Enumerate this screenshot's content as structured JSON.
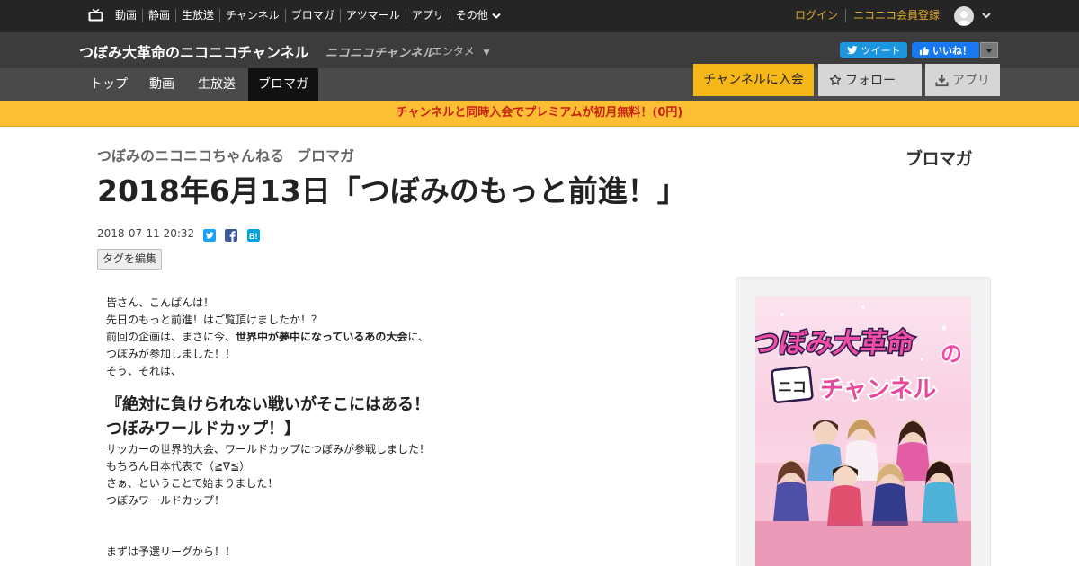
{
  "global_nav": {
    "items": [
      "動画",
      "静画",
      "生放送",
      "チャンネル",
      "ブロマガ",
      "アツマール",
      "アプリ"
    ],
    "more_label": "その他",
    "login_label": "ログイン",
    "signup_label": "ニコニコ会員登録"
  },
  "channel": {
    "name": "つぼみ大革命のニコニコチャンネル",
    "service_logo": "ニコニコチャンネル",
    "genre": "エンタメ",
    "tweet_label": "ツイート",
    "like_label": "いいね！",
    "tabs": [
      "トップ",
      "動画",
      "生放送",
      "ブロマガ"
    ],
    "active_tab": "ブロマガ",
    "join_label": "チャンネルに入会",
    "follow_label": "フォロー",
    "app_label": "アプリ"
  },
  "promo": {
    "text": "チャンネルと同時入会でプレミアムが初月無料！(0円)"
  },
  "article": {
    "channel_short": "つぼみのニコニコちゃんねる",
    "section": "ブロマガ",
    "logo_text": "ブロマガ",
    "title": "2018年6月13日「つぼみのもっと前進！」",
    "date": "2018-07-11 20:32",
    "tag_edit_label": "タグを編集",
    "lines": {
      "l1": "皆さん、こんばんは！",
      "l2": "先日のもっと前進！はご覧頂けましたか！？",
      "l3_a": "前回の企画は、まさに今、",
      "l3_b": "世界中が夢中になっているあの大会",
      "l3_c": "に、",
      "l4": "つぼみが参加しました！！",
      "l5": "そう、それは、",
      "h1": "『絶対に負けられない戦いがそこにはある！",
      "h2": "つぼみワールドカップ！】",
      "l6": "サッカーの世界的大会、ワールドカップにつぼみが参戦しました！",
      "l7": "もちろん日本代表で（≧∇≦）",
      "l8": "さぁ、ということで始まりました！",
      "l9": "つぼみワールドカップ！",
      "l10": "まずは予選リーグから！！"
    }
  },
  "thumbnail": {
    "logo_line1": "つぼみ大革命",
    "logo_particle": "の",
    "nico_mark": "ニコ",
    "logo_line2": "チャンネル"
  },
  "colors": {
    "accent": "#f6b818",
    "promo_bg": "#fcbf34",
    "promo_text": "#c8200f",
    "login_link": "#e0aa2e",
    "twitter": "#1b95e0",
    "facebook": "#1877f2"
  },
  "icons": {
    "tv": "niconico-tv-icon",
    "chevron": "chevron-down-icon",
    "star": "star-outline-icon",
    "download": "download-icon",
    "twitter": "twitter-icon",
    "facebook": "facebook-icon",
    "hatena": "hatena-bookmark-icon"
  }
}
